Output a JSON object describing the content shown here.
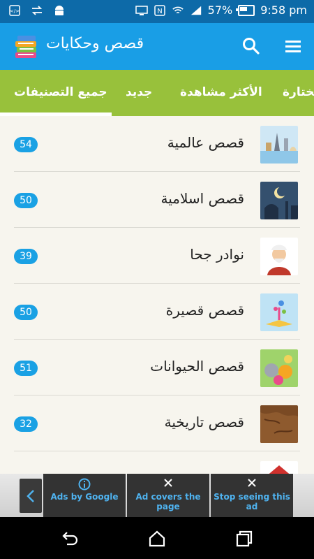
{
  "status_bar": {
    "battery_percent": "57%",
    "time": "9:58 pm"
  },
  "app_bar": {
    "title": "قصص وحكايات"
  },
  "tabs": [
    {
      "label": "جميع التصنيفات",
      "selected": true
    },
    {
      "label": "جديد",
      "selected": false
    },
    {
      "label": "الأكثر مشاهدة",
      "selected": false
    },
    {
      "label": "مختارة",
      "selected": false
    }
  ],
  "categories": [
    {
      "label": "قصص عالمية",
      "count": "54",
      "icon": "world-landmarks-icon"
    },
    {
      "label": "قصص اسلامية",
      "count": "50",
      "icon": "mosque-crescent-icon"
    },
    {
      "label": "نوادر جحا",
      "count": "39",
      "icon": "juha-character-icon"
    },
    {
      "label": "قصص قصيرة",
      "count": "50",
      "icon": "magic-book-icon"
    },
    {
      "label": "قصص الحيوانات",
      "count": "51",
      "icon": "animals-icon"
    },
    {
      "label": "قصص تاريخية",
      "count": "32",
      "icon": "old-map-icon"
    }
  ],
  "ad_bar": {
    "ads_by_google": "Ads by Google",
    "ad_covers_page": "Ad covers the page",
    "stop_seeing_ad": "Stop seeing this ad"
  },
  "colors": {
    "status_bar": "#0d6aa8",
    "app_bar": "#199ee6",
    "tab_bar": "#98c13b",
    "count_badge": "#1aa1e4",
    "background": "#f7f5ee"
  }
}
